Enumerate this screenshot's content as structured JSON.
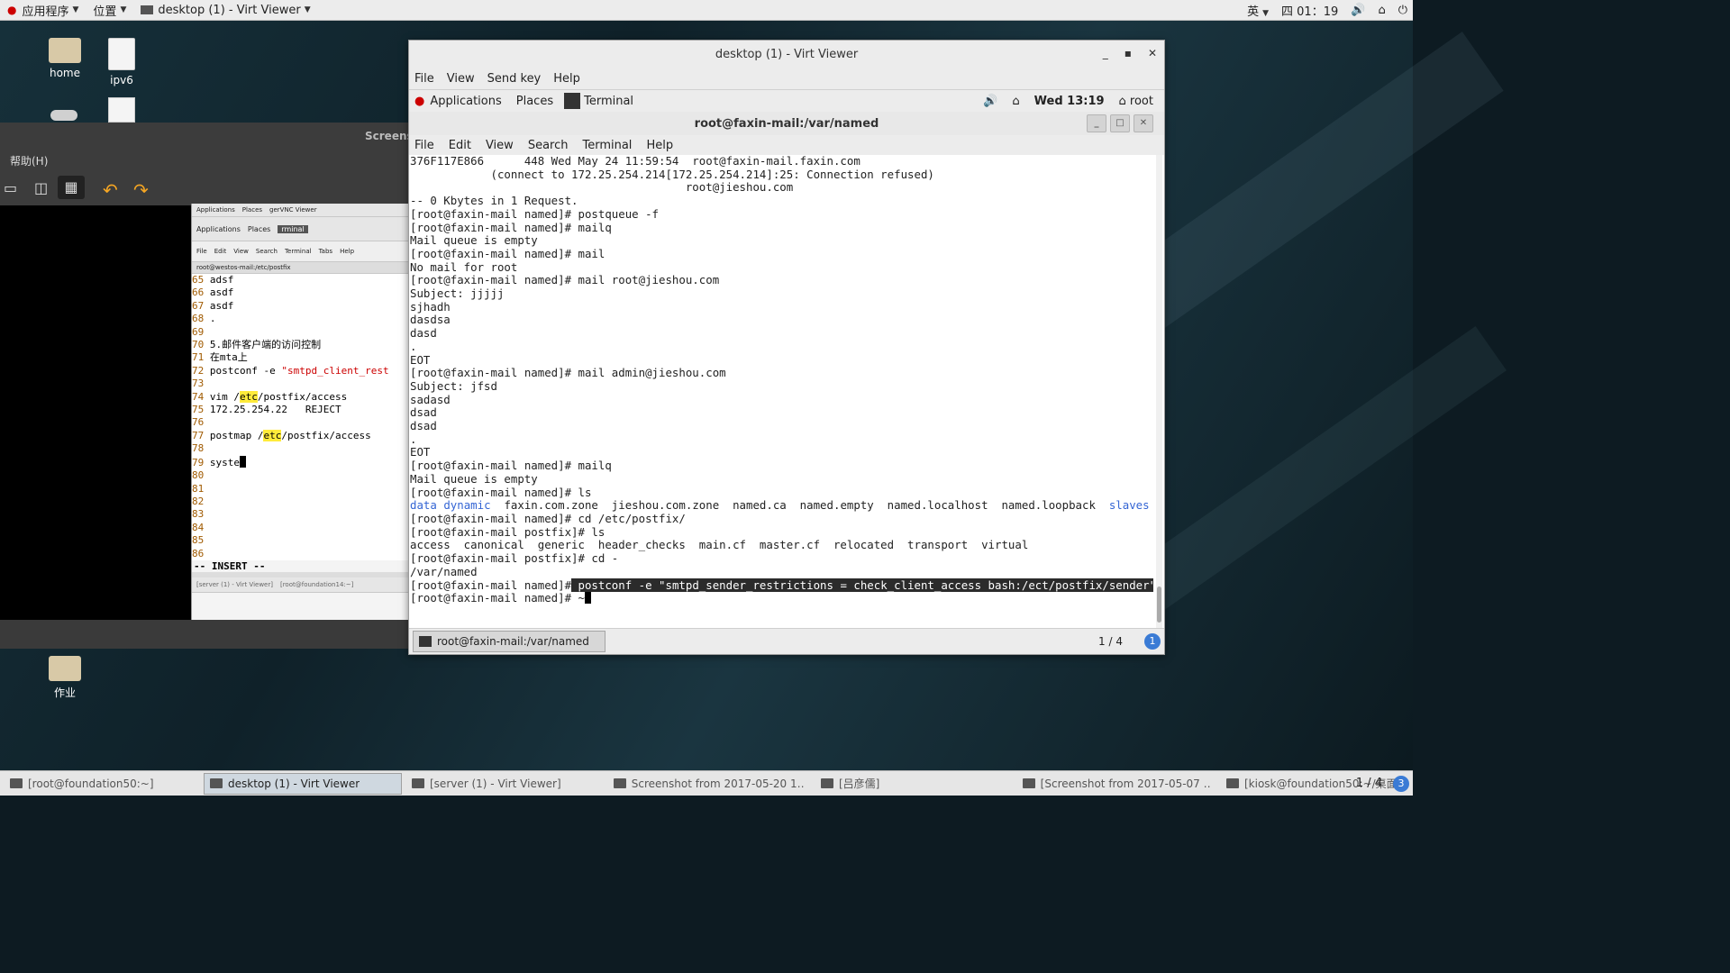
{
  "topbar": {
    "apps": "应用程序",
    "places": "位置",
    "window": "desktop (1) - Virt Viewer",
    "lang": "英",
    "clock": "四 01：19"
  },
  "desktop": {
    "icons": [
      {
        "label": "home"
      },
      {
        "label": "ipv6"
      },
      {
        "label": "作业"
      }
    ]
  },
  "screenshot_viewer": {
    "title": "Screensh",
    "help": "帮助(H)"
  },
  "vnc": {
    "top": {
      "apps": "Applications",
      "places": "Places",
      "window": "gerVNC Viewer"
    },
    "inner": {
      "apps": "Applications",
      "places": "Places",
      "term": "rminal"
    },
    "menu": [
      "File",
      "Edit",
      "View",
      "Search",
      "Terminal",
      "Tabs",
      "Help"
    ],
    "path": "root@westos-mail:/etc/postfix",
    "lines": [
      {
        "n": "65",
        "t": "adsf"
      },
      {
        "n": "66",
        "t": "asdf"
      },
      {
        "n": "67",
        "t": "asdf"
      },
      {
        "n": "68",
        "t": "."
      },
      {
        "n": "69",
        "t": ""
      },
      {
        "n": "70",
        "t": "5.邮件客户端的访问控制"
      },
      {
        "n": "71",
        "t": "在mta上"
      },
      {
        "n": "72",
        "t": "postconf -e ",
        "s": "\"smtpd_client_rest"
      },
      {
        "n": "73",
        "t": ""
      },
      {
        "n": "74",
        "t": "vim /",
        "h": "etc",
        "a": "/postfix/access"
      },
      {
        "n": "75",
        "t": "172.25.254.22   REJECT"
      },
      {
        "n": "76",
        "t": ""
      },
      {
        "n": "77",
        "t": "postmap /",
        "h": "etc",
        "a": "/postfix/access"
      },
      {
        "n": "78",
        "t": ""
      },
      {
        "n": "79",
        "t": "syste"
      },
      {
        "n": "80",
        "t": ""
      },
      {
        "n": "81",
        "t": ""
      },
      {
        "n": "82",
        "t": ""
      },
      {
        "n": "83",
        "t": ""
      },
      {
        "n": "84",
        "t": ""
      },
      {
        "n": "85",
        "t": ""
      },
      {
        "n": "86",
        "t": ""
      }
    ],
    "mode": "-- INSERT --",
    "tasks": [
      "[server (1) - Virt Viewer]",
      "[root@foundation14:~]"
    ]
  },
  "virt_viewer": {
    "title": "desktop (1) - Virt Viewer",
    "menu": [
      "File",
      "View",
      "Send key",
      "Help"
    ],
    "guest_top": {
      "apps": "Applications",
      "places": "Places",
      "term": "Terminal",
      "clock": "Wed 13:19",
      "user": "root"
    },
    "terminal": {
      "title": "root@faxin-mail:/var/named",
      "menu": [
        "File",
        "Edit",
        "View",
        "Search",
        "Terminal",
        "Help"
      ],
      "lines": [
        "376F117E866      448 Wed May 24 11:59:54  root@faxin-mail.faxin.com",
        "            (connect to 172.25.254.214[172.25.254.214]:25: Connection refused)",
        "                                         root@jieshou.com",
        "",
        "-- 0 Kbytes in 1 Request.",
        "[root@faxin-mail named]# postqueue -f",
        "[root@faxin-mail named]# mailq",
        "Mail queue is empty",
        "[root@faxin-mail named]# mail",
        "No mail for root",
        "[root@faxin-mail named]# mail root@jieshou.com",
        "Subject: jjjjj",
        "sjhadh",
        "dasdsa",
        "dasd",
        ".",
        "EOT",
        "[root@faxin-mail named]# mail admin@jieshou.com",
        "Subject: jfsd",
        "sadasd",
        "dsad",
        "dsad",
        ".",
        "EOT",
        "[root@faxin-mail named]# mailq",
        "Mail queue is empty",
        "[root@faxin-mail named]# ls"
      ],
      "ls_named": {
        "blue1": "data",
        "blue2": "dynamic",
        "plain": "  faxin.com.zone  jieshou.com.zone  named.ca  named.empty  named.localhost  named.loopback  ",
        "blue3": "slaves"
      },
      "after_lines": [
        "[root@faxin-mail named]# cd /etc/postfix/",
        "[root@faxin-mail postfix]# ls",
        "access  canonical  generic  header_checks  main.cf  master.cf  relocated  transport  virtual",
        "[root@faxin-mail postfix]# cd -",
        "/var/named"
      ],
      "prompt": "[root@faxin-mail named]#",
      "selected": " postconf -e \"smtpd_sender_restrictions = check_client_access bash:/ect/postfix/sender\"",
      "last_prompt": "[root@faxin-mail named]# ~"
    },
    "bottom": {
      "task": "root@faxin-mail:/var/named",
      "page": "1 / 4",
      "badge": "1"
    }
  },
  "taskbar": {
    "tasks": [
      {
        "label": "[root@foundation50:~]",
        "active": false
      },
      {
        "label": "desktop (1) - Virt Viewer",
        "active": true
      },
      {
        "label": "[server (1) - Virt Viewer]",
        "active": false
      },
      {
        "label": "Screenshot from 2017-05-20 1…",
        "active": false
      },
      {
        "label": "[吕彦儒]",
        "active": false
      },
      {
        "label": "[Screenshot from 2017-05-07 …",
        "active": false
      },
      {
        "label": "[kiosk@foundation50:~/桌面]",
        "active": false
      }
    ],
    "page": "1 / 4",
    "badge": "3"
  }
}
